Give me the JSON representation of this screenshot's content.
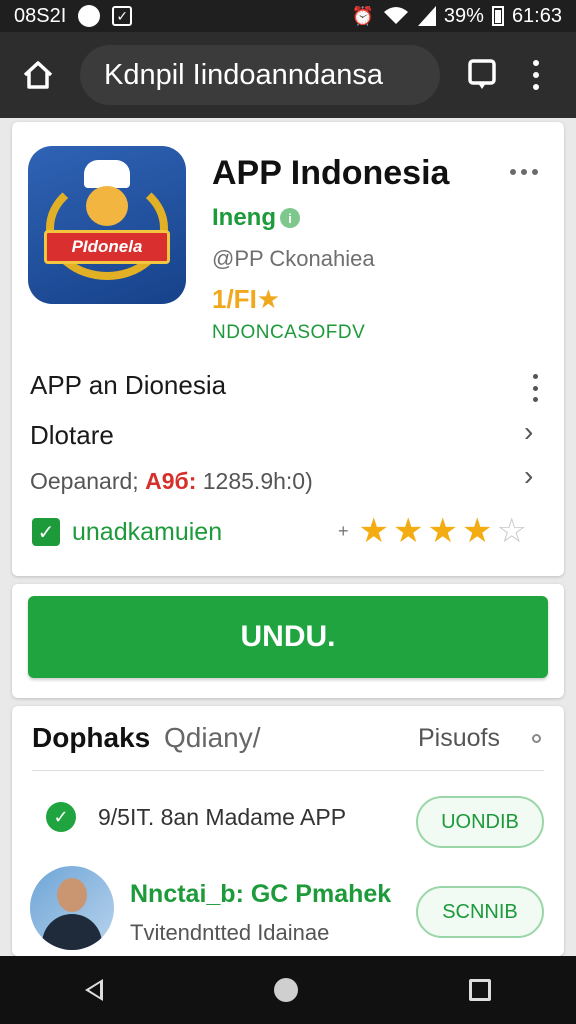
{
  "status_bar": {
    "time_left": "08S2I",
    "battery": "39%",
    "time_right": "61:63"
  },
  "top_bar": {
    "url": "Kdnpil Iindoanndansa"
  },
  "app": {
    "title": "APP Indonesia",
    "developer": "Ineng",
    "info_symbol": "i",
    "handle": "@PP Ckonahiea",
    "rating": "1/FI★",
    "category": "NDONCASOFDV",
    "icon_text": "PIdonela"
  },
  "details": {
    "row1": "APP an Dionesia",
    "row2": "Dlotare",
    "row3_prefix": "Oepanard; ",
    "row3_highlight": "A9б: ",
    "row3_suffix": "1285.9h:0)",
    "check_label": "unadkamuien",
    "star_prefix": "+",
    "rating_stars_filled": 4,
    "rating_stars_total": 5
  },
  "download": {
    "label": "UNDU."
  },
  "section": {
    "title": "Dophaks",
    "subtitle": "Qdiany/",
    "right_label": "Pisuofs",
    "items": [
      {
        "text": "9/5IT. 8an Madame APP",
        "button": "UONDIB"
      },
      {
        "name": "Nnctai_b: GC Pmahek",
        "desc": "Tvitendntted Idainae",
        "button": "SCNNIB"
      }
    ]
  },
  "colors": {
    "accent_green": "#1fa43f",
    "star": "#f3ad13",
    "highlight_red": "#d6302a"
  }
}
